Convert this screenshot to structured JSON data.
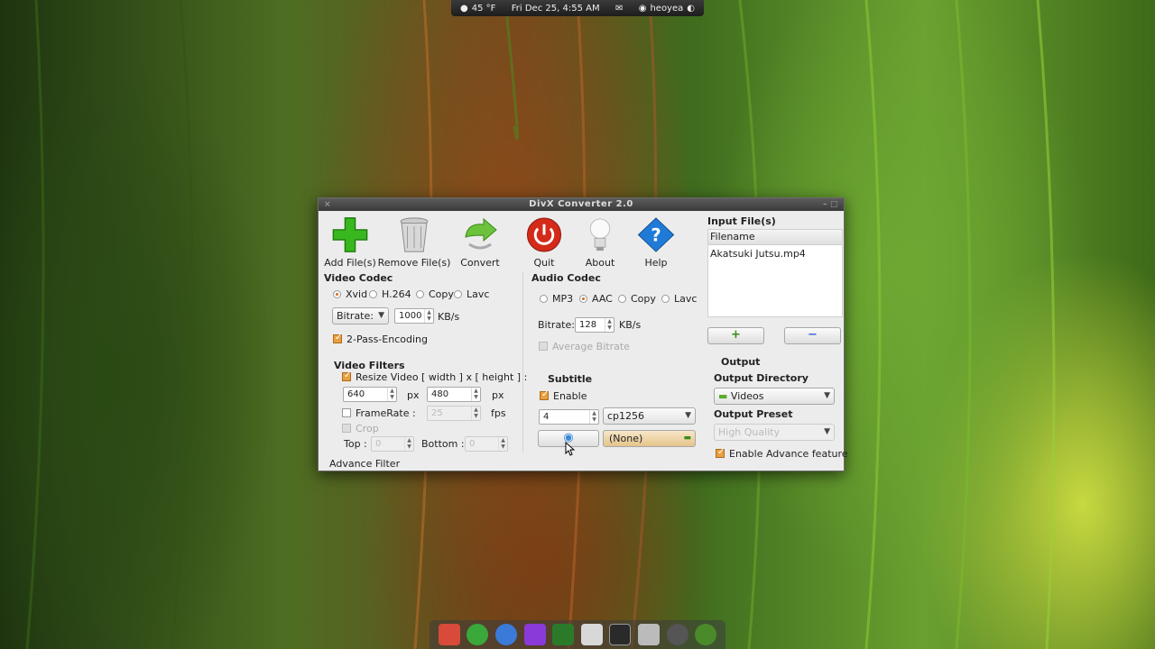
{
  "top_panel": {
    "weather": "45 °F",
    "datetime": "Fri Dec 25,  4:55 AM",
    "user": "heoyea"
  },
  "window": {
    "title": "DivX Converter 2.0"
  },
  "toolbar": {
    "add_label": "Add File(s)",
    "remove_label": "Remove File(s)",
    "convert_label": "Convert",
    "quit_label": "Quit",
    "about_label": "About",
    "help_label": "Help"
  },
  "video_codec": {
    "title": "Video Codec",
    "options": [
      "Xvid",
      "H.264",
      "Copy",
      "Lavc"
    ],
    "selected": "Xvid",
    "mode_value": "Bitrate:",
    "bitrate_value": "1000",
    "bitrate_unit": "KB/s",
    "two_pass_label": "2-Pass-Encoding"
  },
  "video_filters": {
    "title": "Video Filters",
    "resize_label": "Resize Video  [ width ] x [ height ] :",
    "width_value": "640",
    "height_value": "480",
    "px_unit": "px",
    "framerate_label": "FrameRate :",
    "framerate_value": "25",
    "fps_unit": "fps",
    "crop_label": "Crop",
    "top_label": "Top :",
    "top_value": "0",
    "bottom_label": "Bottom :",
    "bottom_value": "0",
    "advance_filter_label": "Advance Filter"
  },
  "audio_codec": {
    "title": "Audio Codec",
    "options": [
      "MP3",
      "AAC",
      "Copy",
      "Lavc"
    ],
    "selected": "AAC",
    "bitrate_label": "Bitrate:",
    "bitrate_value": "128",
    "bitrate_unit": "KB/s",
    "average_bitrate_label": "Average Bitrate"
  },
  "subtitle": {
    "title": "Subtitle",
    "enable_label": "Enable",
    "size_value": "4",
    "encoding_value": "cp1256",
    "file_value": "(None)"
  },
  "input_files": {
    "title": "Input File(s)",
    "column_header": "Filename",
    "files": [
      "Akatsuki Jutsu.mp4"
    ],
    "add_button": "+",
    "remove_button": "−"
  },
  "output": {
    "title": "Output",
    "directory_label": "Output Directory",
    "directory_value": "Videos",
    "preset_label": "Output Preset",
    "preset_value": "High Quality",
    "advance_feature_label": "Enable Advance feature"
  },
  "dock": {
    "icons": [
      "anchor-icon",
      "globe-icon",
      "browser-icon",
      "folder-icon",
      "terminal-icon",
      "archive-icon",
      "window-icon",
      "trash-icon",
      "disc-icon",
      "power-icon"
    ]
  }
}
